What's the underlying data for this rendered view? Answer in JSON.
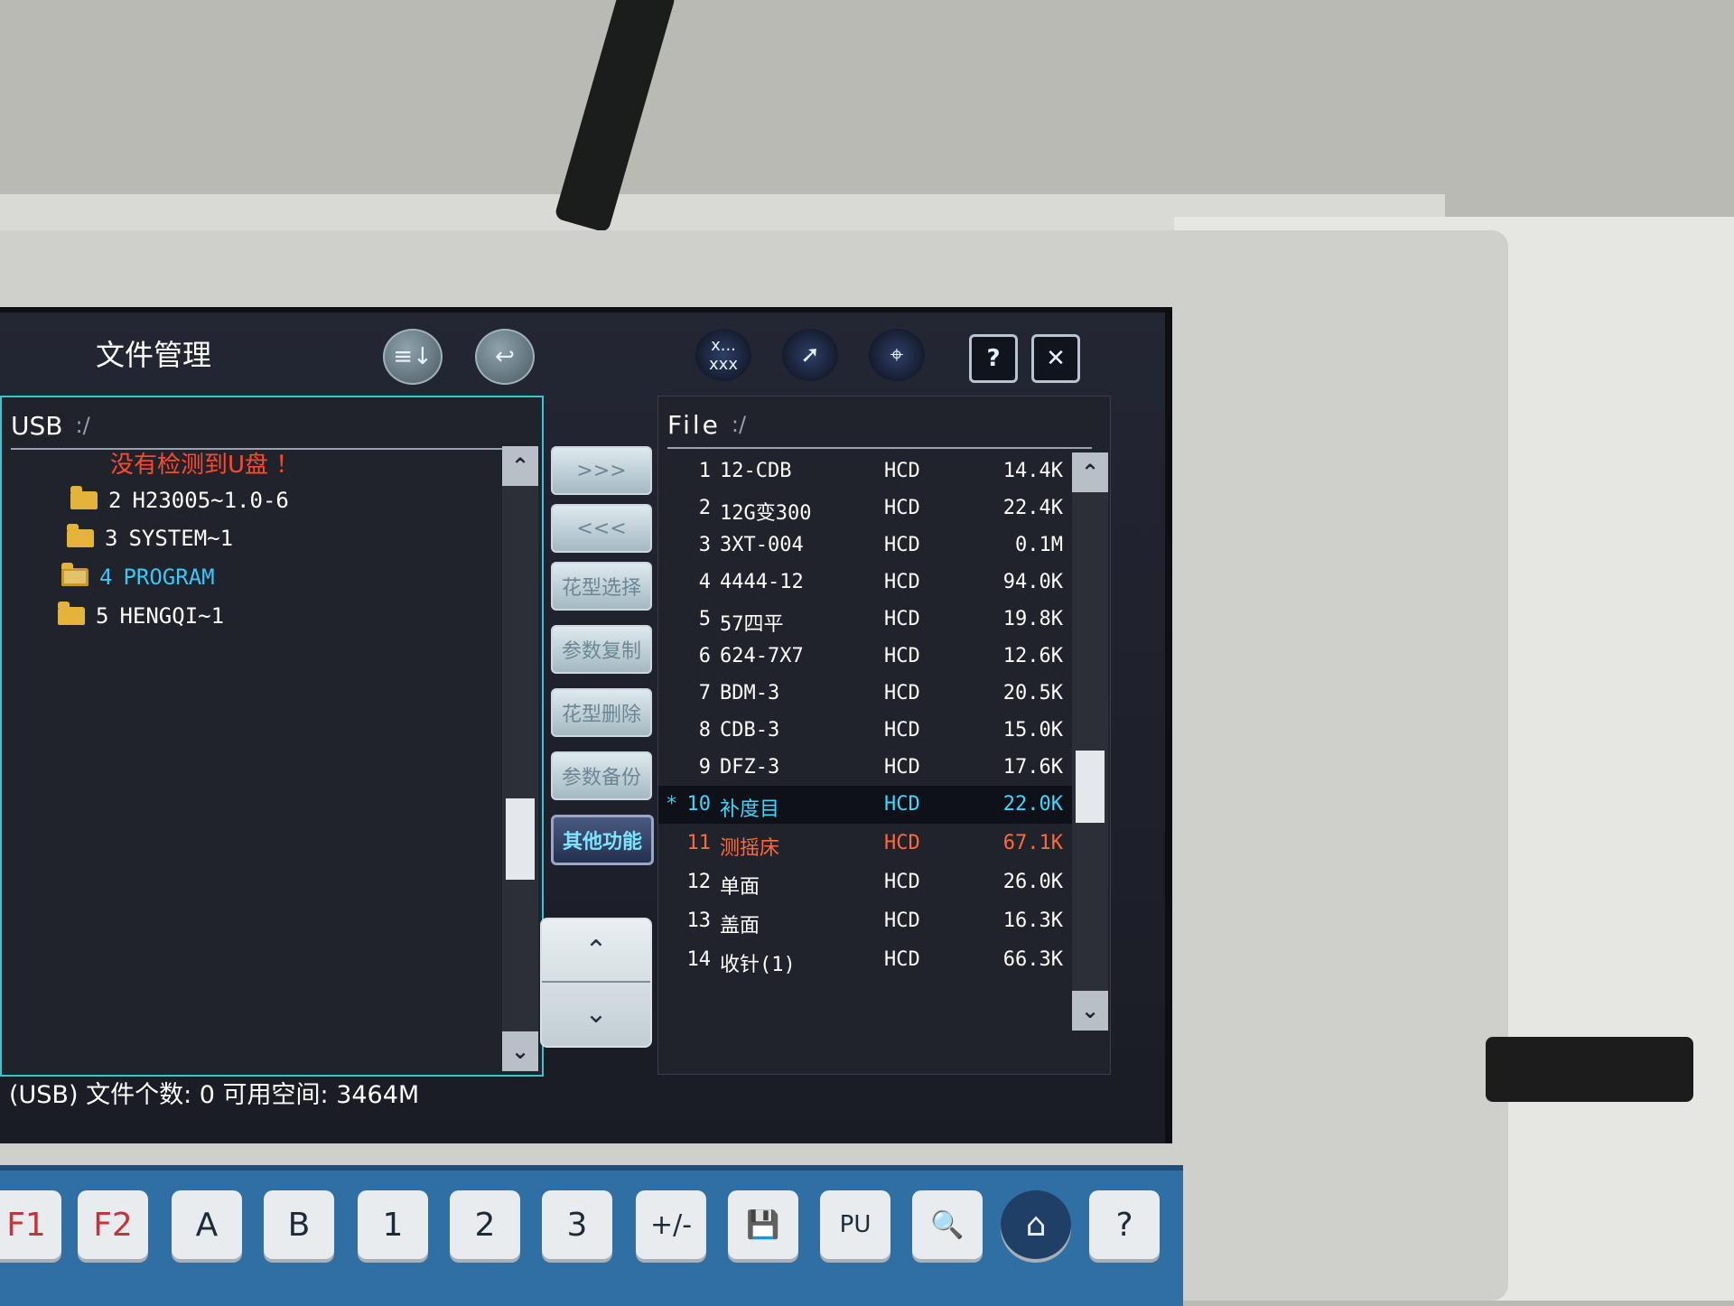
{
  "window": {
    "title": "文件管理"
  },
  "toolbar": {
    "sort_icon": "sort-icon",
    "back_icon": "return-icon",
    "rename_label": "xxx",
    "rename_top_label": "x...",
    "select_icon": "pointer-icon",
    "center_icon": "center-icon",
    "help_label": "?",
    "close_label": "✕"
  },
  "left_panel": {
    "device": "USB",
    "path": ":/",
    "warning": "没有检测到U盘 ！",
    "items": [
      {
        "index": "2",
        "name": "H23005~1.0-6"
      },
      {
        "index": "3",
        "name": "SYSTEM~1"
      },
      {
        "index": "4",
        "name": "PROGRAM",
        "selected": true
      },
      {
        "index": "5",
        "name": "HENGQI~1"
      }
    ]
  },
  "middle_buttons": [
    {
      "label": ">>>"
    },
    {
      "label": "<<<"
    },
    {
      "label": "花型选择"
    },
    {
      "label": "参数复制"
    },
    {
      "label": "花型删除"
    },
    {
      "label": "参数备份"
    },
    {
      "label": "其他功能",
      "active": true
    }
  ],
  "updown": {
    "up": "⌃",
    "down": "⌄"
  },
  "right_panel": {
    "device": "File",
    "path": ":/",
    "files": [
      {
        "mark": "",
        "num": "1",
        "name": "12-CDB",
        "ext": "HCD",
        "size": "14.4K"
      },
      {
        "mark": "",
        "num": "2",
        "name": "12G变300",
        "ext": "HCD",
        "size": "22.4K"
      },
      {
        "mark": "",
        "num": "3",
        "name": "3XT-004",
        "ext": "HCD",
        "size": "0.1M"
      },
      {
        "mark": "",
        "num": "4",
        "name": "4444-12",
        "ext": "HCD",
        "size": "94.0K"
      },
      {
        "mark": "",
        "num": "5",
        "name": "57四平",
        "ext": "HCD",
        "size": "19.8K"
      },
      {
        "mark": "",
        "num": "6",
        "name": "624-7X7",
        "ext": "HCD",
        "size": "12.6K"
      },
      {
        "mark": "",
        "num": "7",
        "name": "BDM-3",
        "ext": "HCD",
        "size": "20.5K"
      },
      {
        "mark": "",
        "num": "8",
        "name": "CDB-3",
        "ext": "HCD",
        "size": "15.0K"
      },
      {
        "mark": "",
        "num": "9",
        "name": "DFZ-3",
        "ext": "HCD",
        "size": "17.6K"
      },
      {
        "mark": "*",
        "num": "10",
        "name": "补度目",
        "ext": "HCD",
        "size": "22.0K",
        "state": "current"
      },
      {
        "mark": "",
        "num": "11",
        "name": "测摇床",
        "ext": "HCD",
        "size": "67.1K",
        "state": "alert"
      },
      {
        "mark": "",
        "num": "12",
        "name": "单面",
        "ext": "HCD",
        "size": "26.0K"
      },
      {
        "mark": "",
        "num": "13",
        "name": "盖面",
        "ext": "HCD",
        "size": "16.3K"
      },
      {
        "mark": "",
        "num": "14",
        "name": "收针(1)",
        "ext": "HCD",
        "size": "66.3K"
      }
    ]
  },
  "status": {
    "text": "(USB) 文件个数: 0   可用空间: 3464M"
  },
  "keypad": [
    {
      "label": "F1",
      "style": "red"
    },
    {
      "label": "F2",
      "style": "red"
    },
    {
      "label": "A"
    },
    {
      "label": "B"
    },
    {
      "label": "1"
    },
    {
      "label": "2"
    },
    {
      "label": "3"
    },
    {
      "label": "+/-"
    },
    {
      "label": "💾",
      "icon": "save-icon"
    },
    {
      "label": "PU"
    },
    {
      "label": "🔍",
      "icon": "search-icon"
    },
    {
      "label": "⌂",
      "icon": "home-icon",
      "style": "roundkey"
    },
    {
      "label": "?"
    }
  ],
  "colors": {
    "panel_border": "#38c6d6",
    "warning": "#ff4a2a",
    "current_row": "#3fd6ff",
    "alert_row": "#ff6a3a",
    "keypad": "#2f6fa4"
  }
}
